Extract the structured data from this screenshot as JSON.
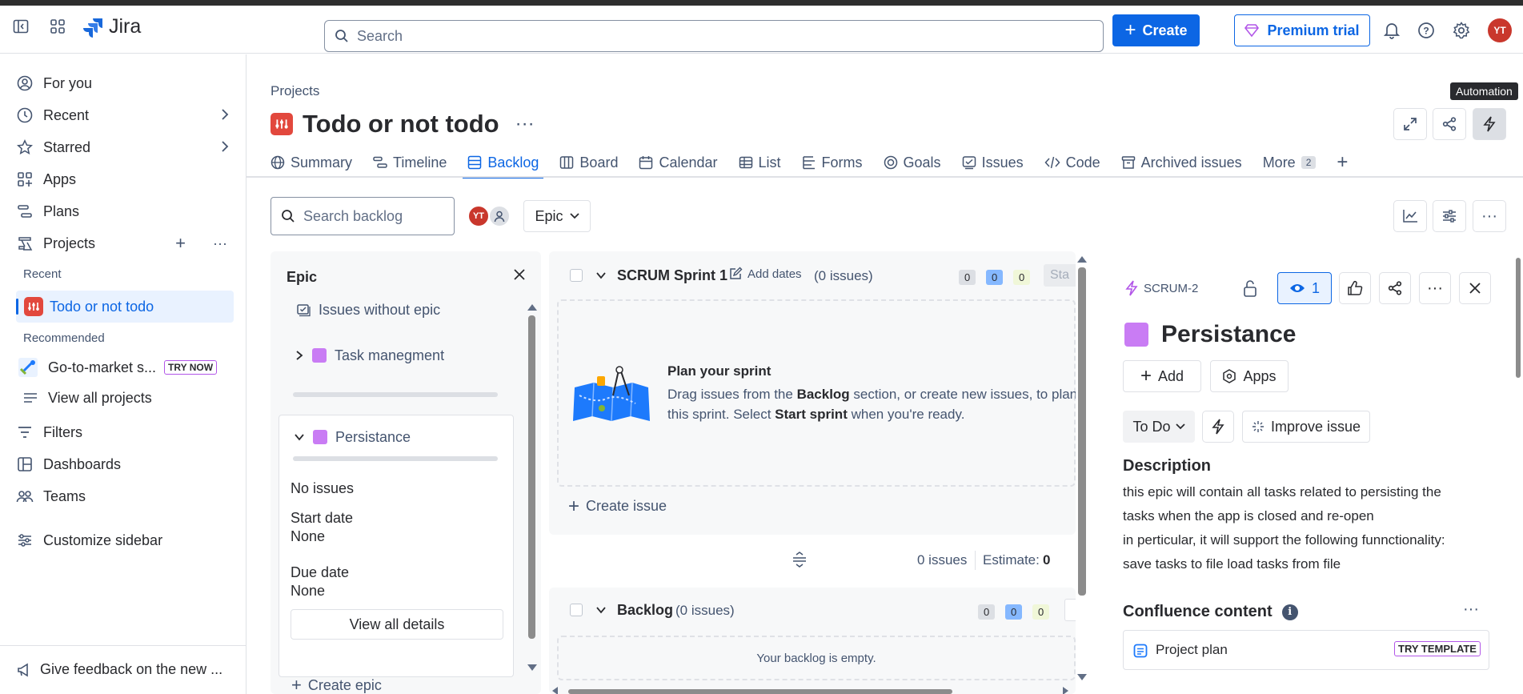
{
  "app": {
    "name": "Jira"
  },
  "topnav": {
    "search_placeholder": "Search",
    "create_label": "Create",
    "premium_label": "Premium trial",
    "avatar_initials": "YT"
  },
  "sidebar": {
    "items": [
      {
        "label": "For you"
      },
      {
        "label": "Recent"
      },
      {
        "label": "Starred"
      },
      {
        "label": "Apps"
      },
      {
        "label": "Plans"
      },
      {
        "label": "Projects"
      }
    ],
    "recent_heading": "Recent",
    "recent_project": "Todo or not todo",
    "recommended_heading": "Recommended",
    "recommended_item": "Go-to-market s...",
    "try_now": "TRY NOW",
    "view_all_projects": "View all projects",
    "filters": "Filters",
    "dashboards": "Dashboards",
    "teams": "Teams",
    "customize": "Customize sidebar",
    "feedback": "Give feedback on the new ..."
  },
  "header": {
    "breadcrumb": "Projects",
    "title": "Todo or not todo",
    "tooltip": "Automation"
  },
  "tabs": [
    {
      "label": "Summary"
    },
    {
      "label": "Timeline"
    },
    {
      "label": "Backlog"
    },
    {
      "label": "Board"
    },
    {
      "label": "Calendar"
    },
    {
      "label": "List"
    },
    {
      "label": "Forms"
    },
    {
      "label": "Goals"
    },
    {
      "label": "Issues"
    },
    {
      "label": "Code"
    },
    {
      "label": "Archived issues"
    },
    {
      "label": "More"
    }
  ],
  "more_count": "2",
  "toolbar": {
    "search_placeholder": "Search backlog",
    "avatar_initials": "YT",
    "epic_filter": "Epic"
  },
  "epic_panel": {
    "title": "Epic",
    "no_epic": "Issues without epic",
    "epics": [
      {
        "name": "Task manegment",
        "color": "#c97cf4"
      },
      {
        "name": "Persistance",
        "color": "#c97cf4"
      }
    ],
    "no_issues": "No issues",
    "start_label": "Start date",
    "start_value": "None",
    "due_label": "Due date",
    "due_value": "None",
    "view_details": "View all details",
    "create_epic": "Create epic"
  },
  "sprint": {
    "name": "SCRUM Sprint 1",
    "add_dates": "Add dates",
    "issue_count": "(0 issues)",
    "counts": [
      "0",
      "0",
      "0"
    ],
    "start_btn": "Sta",
    "plan_title": "Plan your sprint",
    "plan_text_1": "Drag issues from the ",
    "plan_text_bold_1": "Backlog",
    "plan_text_2": " section, or create new issues, to plan",
    "plan_text_3": "this sprint. Select ",
    "plan_text_bold_2": "Start sprint",
    "plan_text_4": " when you're ready.",
    "create_issue": "Create issue",
    "footer_issues": "0 issues",
    "estimate_label": "Estimate:",
    "estimate_value": "0"
  },
  "backlog": {
    "name": "Backlog",
    "issue_count": "(0 issues)",
    "counts": [
      "0",
      "0",
      "0"
    ],
    "empty": "Your backlog is empty."
  },
  "detail": {
    "key": "SCRUM-2",
    "watch_count": "1",
    "title": "Persistance",
    "add_label": "Add",
    "apps_label": "Apps",
    "status": "To Do",
    "improve": "Improve issue",
    "description_heading": "Description",
    "description_lines": [
      "this epic will contain all tasks related to persisting the",
      "tasks when the app is closed and re-open",
      "in perticular, it will support the following funnctionality:",
      "save tasks to file load tasks from file"
    ],
    "confluence_heading": "Confluence content",
    "project_plan": "Project plan",
    "try_template": "TRY TEMPLATE"
  },
  "colors": {
    "accent": "#0c66e4",
    "epic": "#c97cf4",
    "avatar": "#c9372c"
  }
}
